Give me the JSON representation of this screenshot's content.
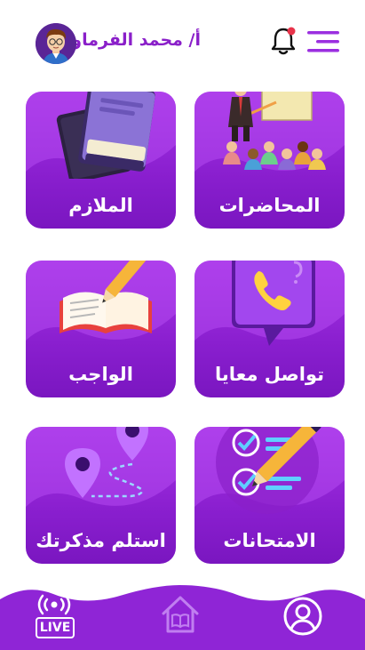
{
  "header": {
    "teacher_name": "أ/ محمد الفرماوي",
    "menu_icon": "hamburger-menu-icon",
    "bell_icon": "notification-bell-icon",
    "notification_dot_color": "#e8334a"
  },
  "cards": [
    {
      "id": "lectures",
      "label": "المحاضرات",
      "icon": "lecture-presentation-icon"
    },
    {
      "id": "booklets",
      "label": "الملازم",
      "icon": "books-icon"
    },
    {
      "id": "contact",
      "label": "تواصل معايا",
      "icon": "phone-chat-icon"
    },
    {
      "id": "homework",
      "label": "الواجب",
      "icon": "notebook-pencil-icon"
    },
    {
      "id": "exams",
      "label": "الامتحانات",
      "icon": "checklist-pencil-icon"
    },
    {
      "id": "receive",
      "label": "استلم مذكرتك",
      "icon": "map-route-icon"
    }
  ],
  "bottom_nav": {
    "live_label": "LIVE",
    "items": [
      "live-broadcast-icon",
      "home-book-icon",
      "profile-icon"
    ]
  },
  "colors": {
    "brand_purple": "#8a1fc9",
    "card_top": "#a733e6",
    "card_bottom": "#7a16c0",
    "nav_purple": "#8f25d6"
  }
}
